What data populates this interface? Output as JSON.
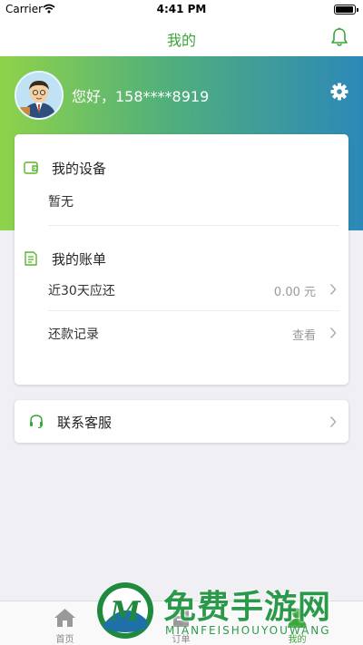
{
  "status_bar": {
    "carrier": "Carrier",
    "time": "4:41 PM"
  },
  "nav": {
    "title": "我的",
    "notification_icon": "bell-icon"
  },
  "profile": {
    "greeting": "您好，158****8919",
    "settings_icon": "gear-icon"
  },
  "devices": {
    "title": "我的设备",
    "empty_text": "暂无",
    "icon": "wallet-icon"
  },
  "bills": {
    "title": "我的账单",
    "icon": "document-icon",
    "rows": [
      {
        "label": "近30天应还",
        "value": "0.00 元"
      },
      {
        "label": "还款记录",
        "value": "查看"
      }
    ]
  },
  "service": {
    "label": "联系客服",
    "icon": "headset-icon"
  },
  "tabs": [
    {
      "label": "首页",
      "icon": "home-icon"
    },
    {
      "label": "订单",
      "icon": "orders-icon"
    },
    {
      "label": "我的",
      "icon": "user-icon"
    }
  ],
  "watermark": {
    "title": "免费手游网",
    "subtitle": "MIANFEISHOUYOUWANG",
    "logo_letter": "M"
  },
  "colors": {
    "accent": "#3aa53a",
    "gradient_start": "#8fd34a",
    "gradient_end": "#2c88b8",
    "background": "#efeff4"
  }
}
